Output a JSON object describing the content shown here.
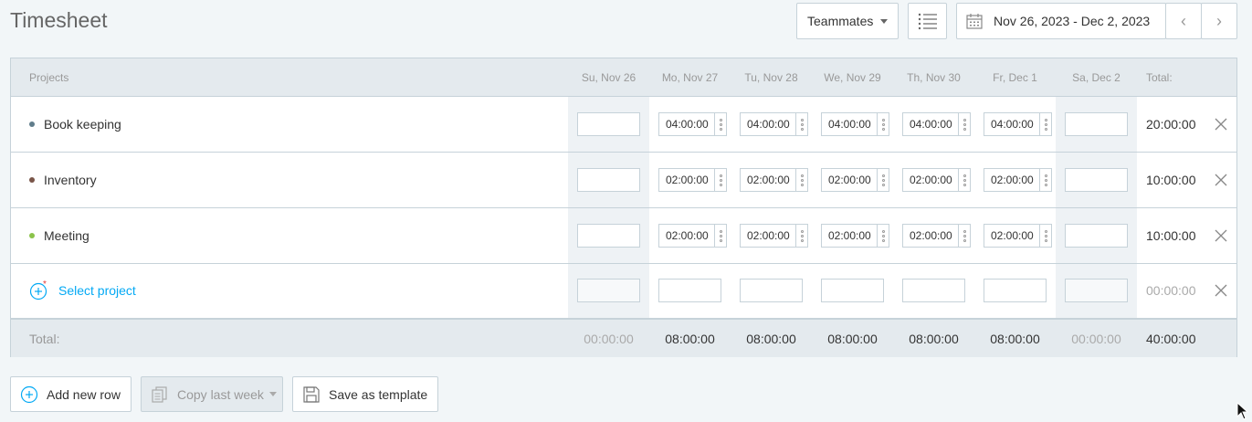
{
  "page": {
    "title": "Timesheet"
  },
  "toolbar": {
    "teammates_label": "Teammates",
    "date_range": "Nov 26, 2023 - Dec 2, 2023",
    "prev_label": "‹",
    "next_label": "›"
  },
  "table": {
    "projects_header": "Projects",
    "total_header": "Total:",
    "days": [
      "Su, Nov 26",
      "Mo, Nov 27",
      "Tu, Nov 28",
      "We, Nov 29",
      "Th, Nov 30",
      "Fr, Dec 1",
      "Sa, Dec 2"
    ],
    "rows": [
      {
        "project": "Book keeping",
        "color": "#607d8b",
        "values": [
          "",
          "04:00:00",
          "04:00:00",
          "04:00:00",
          "04:00:00",
          "04:00:00",
          ""
        ],
        "total": "20:00:00"
      },
      {
        "project": "Inventory",
        "color": "#795548",
        "values": [
          "",
          "02:00:00",
          "02:00:00",
          "02:00:00",
          "02:00:00",
          "02:00:00",
          ""
        ],
        "total": "10:00:00"
      },
      {
        "project": "Meeting",
        "color": "#8bc34a",
        "values": [
          "",
          "02:00:00",
          "02:00:00",
          "02:00:00",
          "02:00:00",
          "02:00:00",
          ""
        ],
        "total": "10:00:00"
      }
    ],
    "new_row": {
      "select_label": "Select project",
      "total": "00:00:00"
    },
    "totals": {
      "label": "Total:",
      "days": [
        "00:00:00",
        "08:00:00",
        "08:00:00",
        "08:00:00",
        "08:00:00",
        "08:00:00",
        "00:00:00"
      ],
      "grand_total": "40:00:00"
    }
  },
  "actions": {
    "add_row": "Add new row",
    "copy_last_week": "Copy last week",
    "save_template": "Save as template"
  },
  "icons": {
    "list": "list-icon",
    "calendar": "calendar-icon",
    "delete": "close-icon",
    "add": "plus-circle-icon",
    "copy": "copy-icon",
    "save": "save-icon"
  },
  "colors": {
    "accent": "#03a9f4",
    "weekend_bg": "#eef2f5",
    "header_bg": "#e4eaee"
  }
}
